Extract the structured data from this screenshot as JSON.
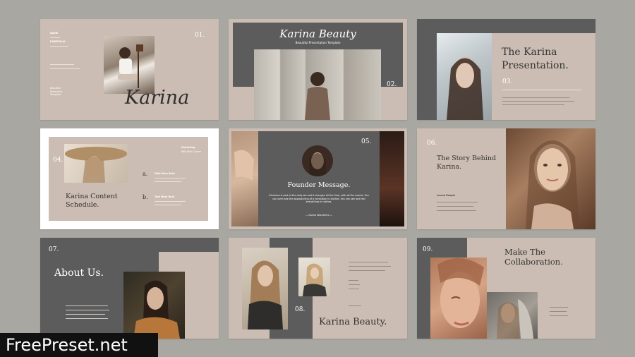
{
  "slides": {
    "s1": {
      "number": "01.",
      "script_title": "Karina",
      "meta1": "NAME",
      "meta2": "PORTFOLIO",
      "side_text": "Beautiful Minimalist Template"
    },
    "s2": {
      "number": "02.",
      "title": "Karina Beauty",
      "subtitle": "Beautiful Presentation Template"
    },
    "s3": {
      "number": "03.",
      "title": "The Karina Presentation."
    },
    "s4": {
      "number": "04.",
      "title": "Karina Content Schedule.",
      "item_a": "a.",
      "item_b": "b.",
      "item_a_head": "Wild Main Bold",
      "item_b_head": "Text Main Bold",
      "side_head": "Marketing",
      "side_sub": "Wild Main Lorem"
    },
    "s5": {
      "number": "05.",
      "title": "Founder Message.",
      "body": "Kindness is part of the daily we and it changes all the time, with all the events. You can even see the approaching of a revolution in clothes. You can see and feel everything in clothes.",
      "signature": "— Karina Wonderful —"
    },
    "s6": {
      "number": "06.",
      "title": "The Story Behind Karina.",
      "mini_label": "Lorem Rospin"
    },
    "s7": {
      "number": "07.",
      "title": "About Us."
    },
    "s8": {
      "number": "08.",
      "title": "Karina Beauty."
    },
    "s9": {
      "number": "09.",
      "title": "Make The Collaboration."
    }
  },
  "watermark": "FreePreset.net",
  "colors": {
    "background": "#a9a7a1",
    "slide_beige": "#cbbdb3",
    "slide_dark": "#5c5c5c",
    "text_light": "#ffffff",
    "text_dark": "#3a3a3a"
  }
}
